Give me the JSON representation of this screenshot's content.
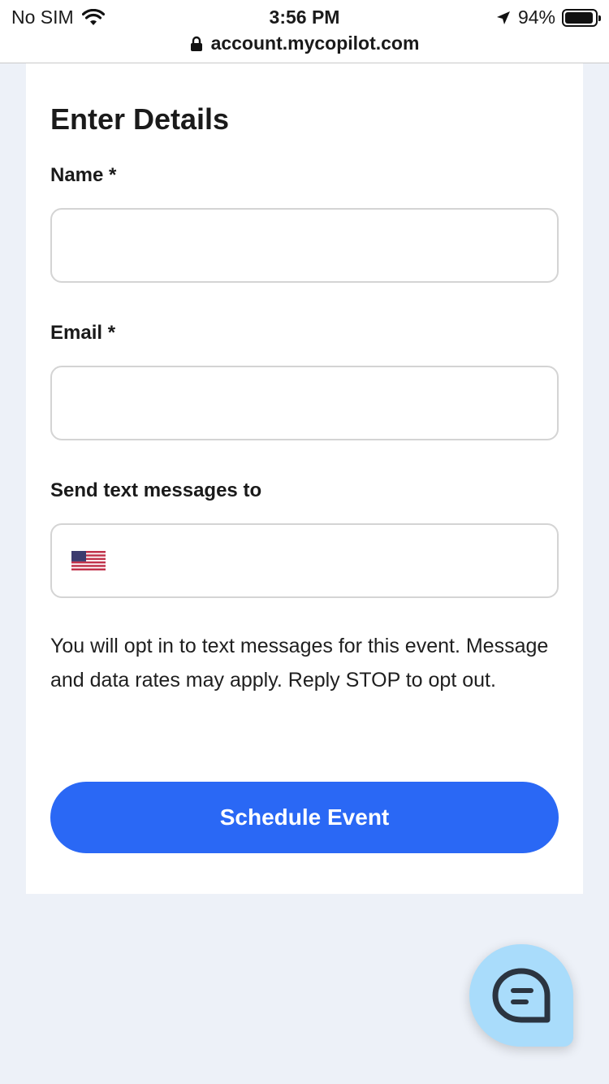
{
  "status_bar": {
    "carrier": "No SIM",
    "time": "3:56 PM",
    "battery": "94%",
    "battery_level": 0.94
  },
  "address_bar": {
    "url": "account.mycopilot.com"
  },
  "form": {
    "title": "Enter Details",
    "name_label": "Name *",
    "name_value": "",
    "email_label": "Email *",
    "email_value": "",
    "phone_label": "Send text messages to",
    "phone_value": "",
    "phone_country": "United States",
    "notice": "You will opt in to text messages for this event. Message and data rates may apply. Reply STOP to opt out.",
    "submit_label": "Schedule Event"
  },
  "colors": {
    "accent": "#2a68f5",
    "page_background": "#edf1f8",
    "chat_bubble": "#a9dcfb",
    "chat_icon": "#2b3440"
  },
  "icons": {
    "wifi": "wifi-icon",
    "location": "location-arrow-icon",
    "lock": "lock-icon",
    "flag": "us-flag-icon",
    "chat": "chat-icon"
  }
}
